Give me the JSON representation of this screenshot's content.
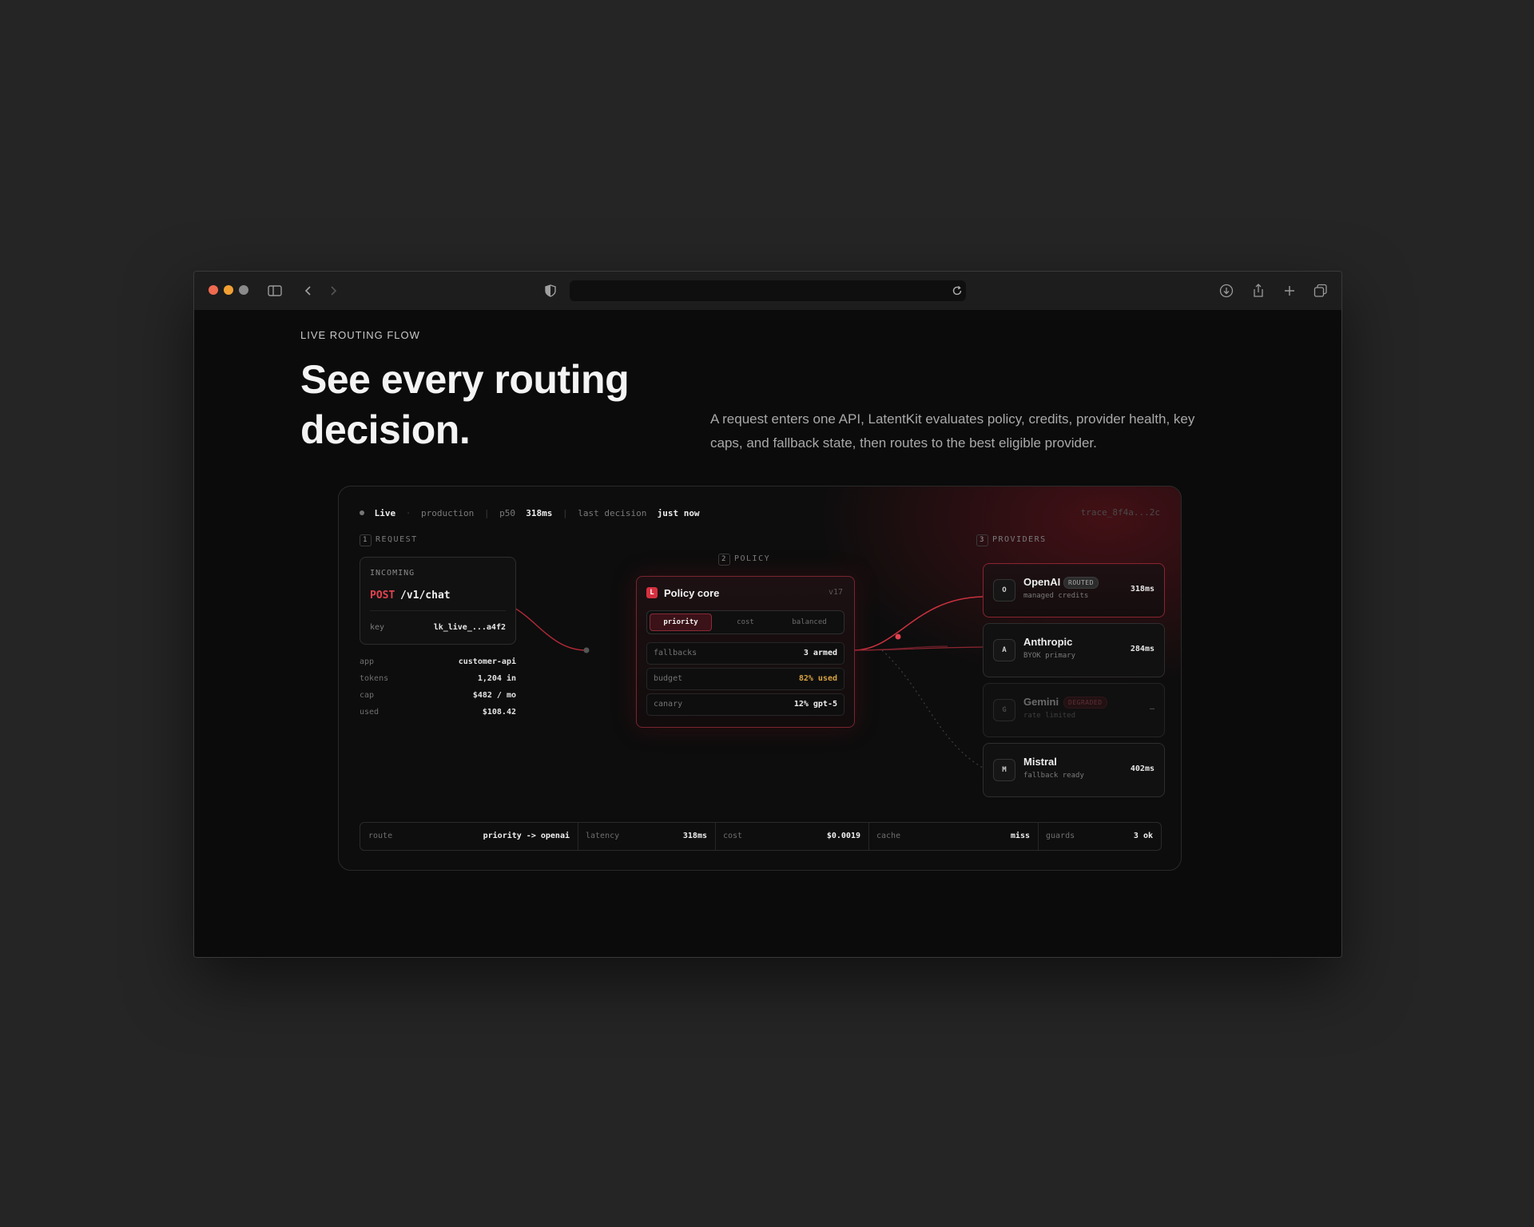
{
  "header": {
    "eyebrow": "LIVE ROUTING FLOW",
    "headline": "See every routing decision.",
    "description": "A request enters one API, LatentKit evaluates policy, credits, provider health, key caps, and fallback state, then routes to the best eligible provider."
  },
  "status": {
    "live": "Live",
    "env": "production",
    "p50_label": "p50",
    "p50_value": "318ms",
    "last_decision_label": "last decision",
    "last_decision_value": "just now",
    "trace": "trace_8f4a...2c"
  },
  "steps": {
    "request": {
      "num": "1",
      "label": "REQUEST"
    },
    "policy": {
      "num": "2",
      "label": "POLICY"
    },
    "providers": {
      "num": "3",
      "label": "PROVIDERS"
    }
  },
  "request": {
    "label": "INCOMING",
    "method": "POST",
    "path": "/v1/chat",
    "key_label": "key",
    "key_value": "lk_live_...a4f2",
    "meta": [
      {
        "k": "app",
        "v": "customer-api"
      },
      {
        "k": "tokens",
        "v": "1,204 in"
      },
      {
        "k": "cap",
        "v": "$482 / mo"
      },
      {
        "k": "used",
        "v": "$108.42"
      }
    ]
  },
  "policy": {
    "badge": "L",
    "title": "Policy core",
    "version": "v17",
    "tabs": [
      "priority",
      "cost",
      "balanced"
    ],
    "active_tab": "priority",
    "rows": [
      {
        "k": "fallbacks",
        "v": "3 armed",
        "color": "#f0f0f0"
      },
      {
        "k": "budget",
        "v": "82% used",
        "color": "#d9a441"
      },
      {
        "k": "canary",
        "v": "12% gpt-5",
        "color": "#f0f0f0"
      }
    ]
  },
  "providers": [
    {
      "initial": "O",
      "name": "OpenAI",
      "sub": "managed credits",
      "latency": "318ms",
      "pill": "ROUTED",
      "state": "routed"
    },
    {
      "initial": "A",
      "name": "Anthropic",
      "sub": "BYOK primary",
      "latency": "284ms",
      "pill": "",
      "state": "normal"
    },
    {
      "initial": "G",
      "name": "Gemini",
      "sub": "rate limited",
      "latency": "–",
      "pill": "DEGRADED",
      "state": "degraded"
    },
    {
      "initial": "M",
      "name": "Mistral",
      "sub": "fallback ready",
      "latency": "402ms",
      "pill": "",
      "state": "normal"
    }
  ],
  "summary": [
    {
      "k": "route",
      "v": "priority -> openai"
    },
    {
      "k": "latency",
      "v": "318ms"
    },
    {
      "k": "cost",
      "v": "$0.0019"
    },
    {
      "k": "cache",
      "v": "miss"
    },
    {
      "k": "guards",
      "v": "3 ok"
    }
  ],
  "colors": {
    "accent": "#e2424f",
    "warning": "#d9a441",
    "traffic_close": "#ee6a50",
    "traffic_min": "#f2a033",
    "traffic_max": "#8a8a8a"
  }
}
